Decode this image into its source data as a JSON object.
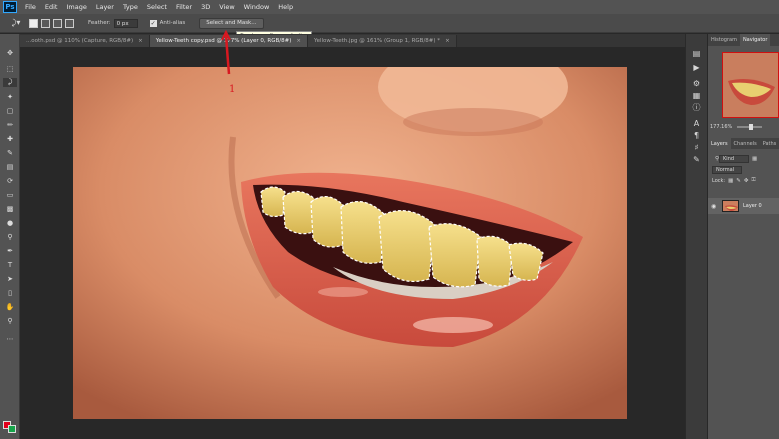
{
  "app": {
    "logo": "Ps"
  },
  "menu": [
    "File",
    "Edit",
    "Image",
    "Layer",
    "Type",
    "Select",
    "Filter",
    "3D",
    "View",
    "Window",
    "Help"
  ],
  "options": {
    "feather_label": "Feather:",
    "feather_value": "0 px",
    "antialias_label": "Anti-alias",
    "select_mask_label": "Select and Mask...",
    "tooltip": "Create or refine a selection"
  },
  "tabs": [
    {
      "label": "...ooth.psd @ 110% (Capture, RGB/8#)",
      "close": "×"
    },
    {
      "label": "Yellow-Teeth copy.psd @ 177% (Layer 0, RGB/8#)",
      "close": "×"
    },
    {
      "label": "Yellow-Teeth.jpg @ 161% (Group 1, RGB/8#) *",
      "close": "×"
    }
  ],
  "annotation": {
    "text": "1",
    "color": "#d81820"
  },
  "panels": {
    "top_tabs": [
      "Histogram",
      "Navigator"
    ],
    "zoom": "177.16%",
    "layers_tabs": [
      "Layers",
      "Channels",
      "Paths"
    ],
    "kind_label": "Kind",
    "blend_mode": "Normal",
    "lock_label": "Lock:",
    "layer_name": "Layer 0"
  },
  "colors": {
    "foreground": "#e0001a",
    "background": "#17a44a",
    "accent": "#31a8ff"
  },
  "icons": {
    "tools": [
      "move-icon",
      "marquee-icon",
      "lasso-icon",
      "quick-select-icon",
      "crop-icon",
      "eyedropper-icon",
      "healing-icon",
      "brush-icon",
      "stamp-icon",
      "history-brush-icon",
      "eraser-icon",
      "gradient-icon",
      "blur-icon",
      "dodge-icon",
      "pen-icon",
      "type-icon",
      "path-select-icon",
      "shape-icon",
      "hand-icon",
      "zoom-icon"
    ]
  }
}
